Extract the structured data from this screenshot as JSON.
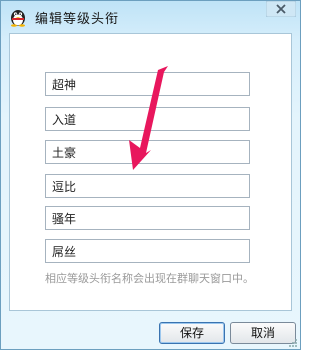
{
  "window": {
    "title": "编辑等级头衔",
    "close_symbol": "×",
    "icon": "qq-penguin-icon"
  },
  "fields": [
    {
      "value": "超神"
    },
    {
      "value": "入道"
    },
    {
      "value": "土豪"
    },
    {
      "value": "逗比"
    },
    {
      "value": "骚年"
    },
    {
      "value": "屌丝"
    }
  ],
  "hint": "相应等级头衔名称会出现在群聊天窗口中。",
  "buttons": {
    "save": "保存",
    "cancel": "取消"
  },
  "colors": {
    "arrow": "#e8175d",
    "title_bg": "#bfe3f7",
    "close_bg": "#c9473c"
  }
}
